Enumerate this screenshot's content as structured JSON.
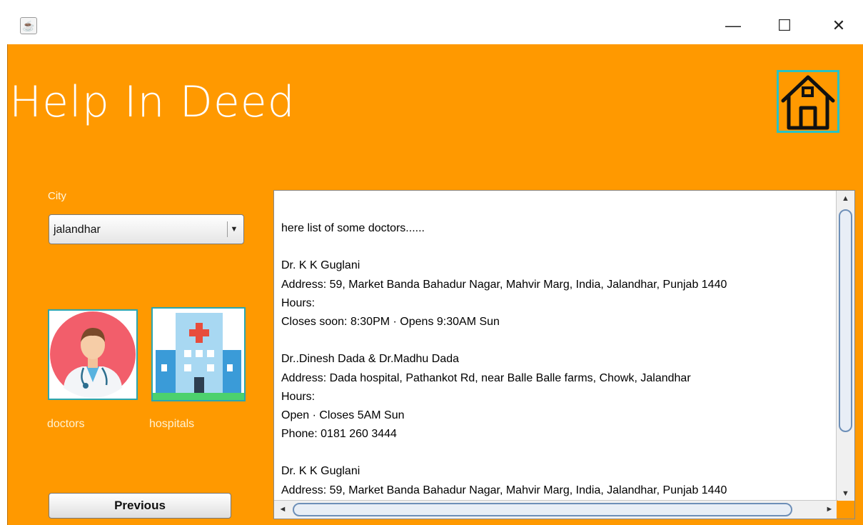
{
  "window": {
    "minimize_glyph": "—",
    "maximize_glyph": "☐",
    "close_glyph": "✕"
  },
  "app": {
    "title": "Help In Deed"
  },
  "city": {
    "label": "City",
    "selected": "jalandhar"
  },
  "categories": {
    "doctors_label": "doctors",
    "hospitals_label": "hospitals"
  },
  "buttons": {
    "previous": "Previous"
  },
  "results": {
    "lines": [
      " here list of some doctors......",
      "",
      "Dr. K K Guglani",
      "Address: 59, Market Banda Bahadur Nagar, Mahvir Marg, India, Jalandhar, Punjab 1440",
      "Hours:",
      "Closes soon: 8:30PM · Opens 9:30AM Sun",
      "",
      "Dr..Dinesh Dada & Dr.Madhu Dada",
      "Address: Dada hospital, Pathankot Rd, near Balle Balle farms, Chowk, Jalandhar",
      "Hours:",
      "Open · Closes 5AM Sun",
      "Phone: 0181 260 3444",
      "",
      "Dr. K K Guglani",
      "Address: 59, Market Banda Bahadur Nagar, Mahvir Marg, India, Jalandhar, Punjab 1440"
    ]
  },
  "colors": {
    "background": "#ff9900",
    "accent": "#27c3c6",
    "title_text": "#ffffff"
  },
  "icons": {
    "app": "java-cup-icon",
    "home": "home-icon",
    "doctor": "doctor-icon",
    "hospital": "hospital-icon"
  }
}
